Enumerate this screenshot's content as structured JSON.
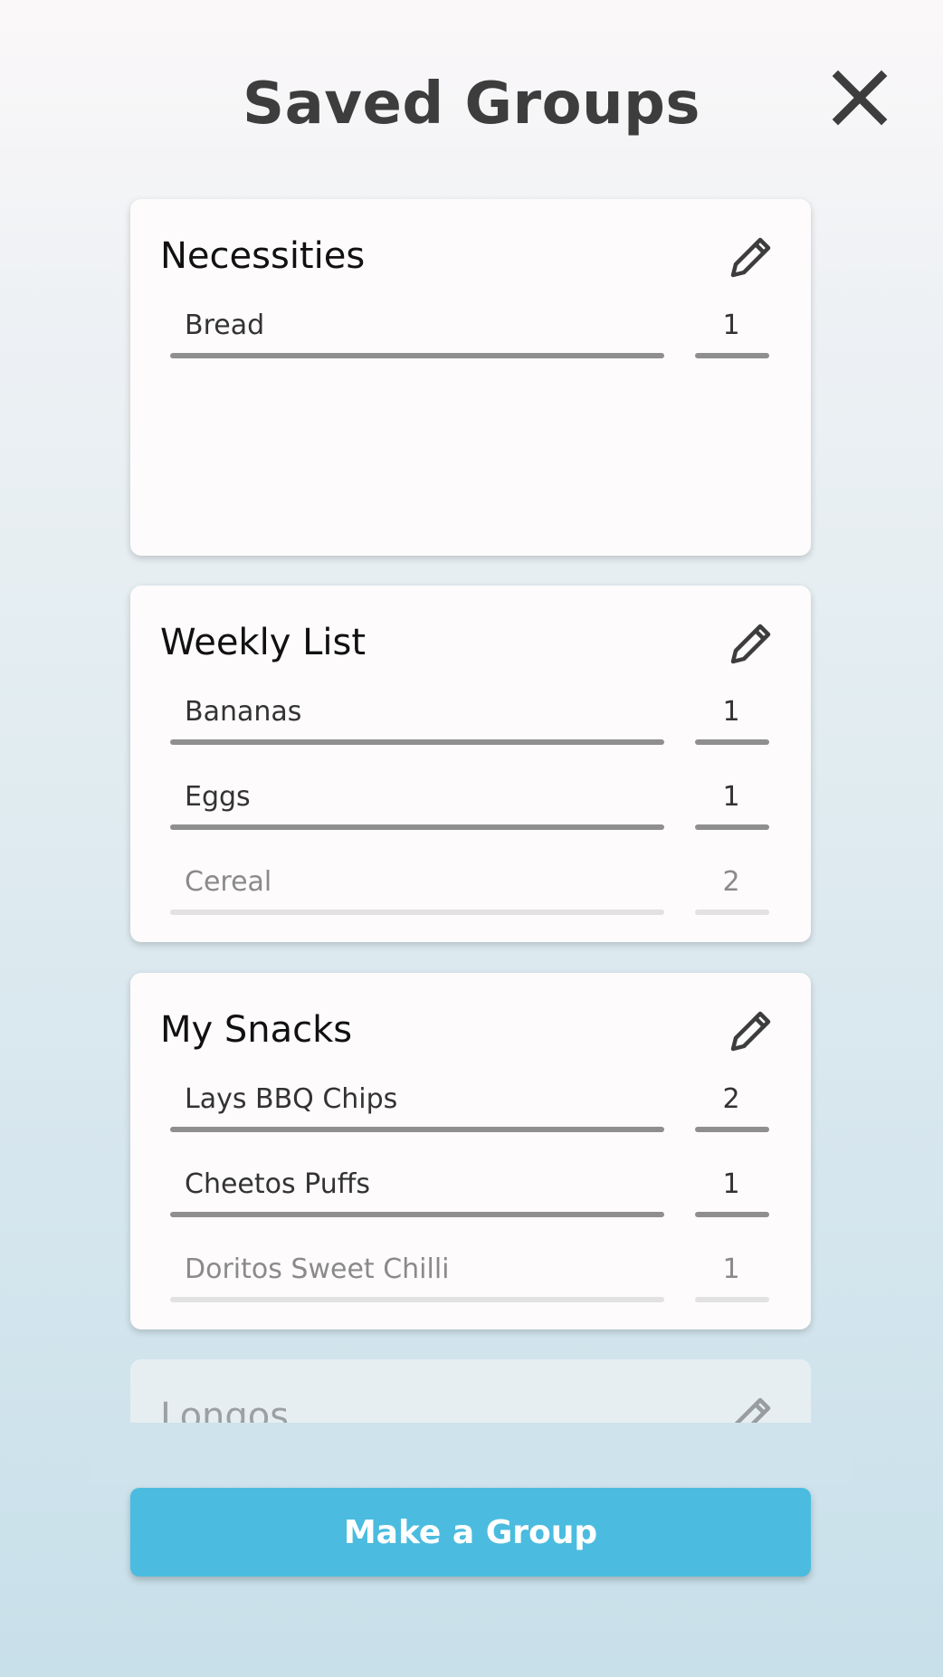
{
  "header": {
    "title": "Saved Groups",
    "close_icon": "close-icon"
  },
  "groups": [
    {
      "name": "Necessities",
      "edit_icon": "pencil-icon",
      "items": [
        {
          "name": "Bread",
          "qty": "1"
        }
      ]
    },
    {
      "name": "Weekly List",
      "edit_icon": "pencil-icon",
      "items": [
        {
          "name": "Bananas",
          "qty": "1"
        },
        {
          "name": "Eggs",
          "qty": "1"
        },
        {
          "name": "Cereal",
          "qty": "2"
        }
      ]
    },
    {
      "name": "My Snacks",
      "edit_icon": "pencil-icon",
      "items": [
        {
          "name": "Lays BBQ Chips",
          "qty": "2"
        },
        {
          "name": "Cheetos Puffs",
          "qty": "1"
        },
        {
          "name": "Doritos Sweet Chilli",
          "qty": "1"
        }
      ]
    },
    {
      "name": "Longos",
      "edit_icon": "pencil-icon",
      "items": []
    }
  ],
  "footer": {
    "make_group_label": "Make a Group"
  },
  "colors": {
    "accent": "#4bbcdf",
    "title_text": "#3d3d3d",
    "card_bg": "#fdfbfb"
  }
}
